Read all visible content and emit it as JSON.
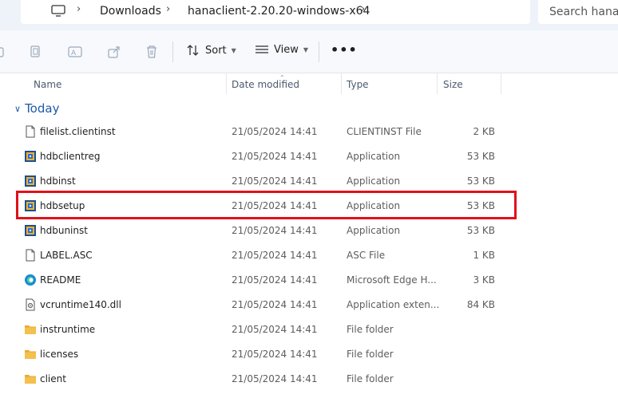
{
  "breadcrumb": {
    "items": [
      "Downloads",
      "hanaclient-2.20.20-windows-x64"
    ]
  },
  "search": {
    "placeholder": "Search hanacli"
  },
  "toolbar": {
    "sort_label": "Sort",
    "view_label": "View",
    "more_label": "•••"
  },
  "columns": {
    "name": "Name",
    "date": "Date modified",
    "type": "Type",
    "size": "Size"
  },
  "group": {
    "label": "Today"
  },
  "files": [
    {
      "name": "filelist.clientinst",
      "date": "21/05/2024 14:41",
      "type": "CLIENTINST File",
      "size": "2 KB",
      "icon": "document-icon"
    },
    {
      "name": "hdbclientreg",
      "date": "21/05/2024 14:41",
      "type": "Application",
      "size": "53 KB",
      "icon": "application-icon"
    },
    {
      "name": "hdbinst",
      "date": "21/05/2024 14:41",
      "type": "Application",
      "size": "53 KB",
      "icon": "application-icon"
    },
    {
      "name": "hdbsetup",
      "date": "21/05/2024 14:41",
      "type": "Application",
      "size": "53 KB",
      "icon": "application-icon"
    },
    {
      "name": "hdbuninst",
      "date": "21/05/2024 14:41",
      "type": "Application",
      "size": "53 KB",
      "icon": "application-icon"
    },
    {
      "name": "LABEL.ASC",
      "date": "21/05/2024 14:41",
      "type": "ASC File",
      "size": "1 KB",
      "icon": "document-icon"
    },
    {
      "name": "README",
      "date": "21/05/2024 14:41",
      "type": "Microsoft Edge H...",
      "size": "3 KB",
      "icon": "edge-icon"
    },
    {
      "name": "vcruntime140.dll",
      "date": "21/05/2024 14:41",
      "type": "Application exten...",
      "size": "84 KB",
      "icon": "dll-icon"
    },
    {
      "name": "instruntime",
      "date": "21/05/2024 14:41",
      "type": "File folder",
      "size": "",
      "icon": "folder-icon"
    },
    {
      "name": "licenses",
      "date": "21/05/2024 14:41",
      "type": "File folder",
      "size": "",
      "icon": "folder-icon"
    },
    {
      "name": "client",
      "date": "21/05/2024 14:41",
      "type": "File folder",
      "size": "",
      "icon": "folder-icon"
    }
  ],
  "colors": {
    "highlight": "#e0111b",
    "group": "#1e5aa8",
    "folder": "#f4c04e"
  }
}
